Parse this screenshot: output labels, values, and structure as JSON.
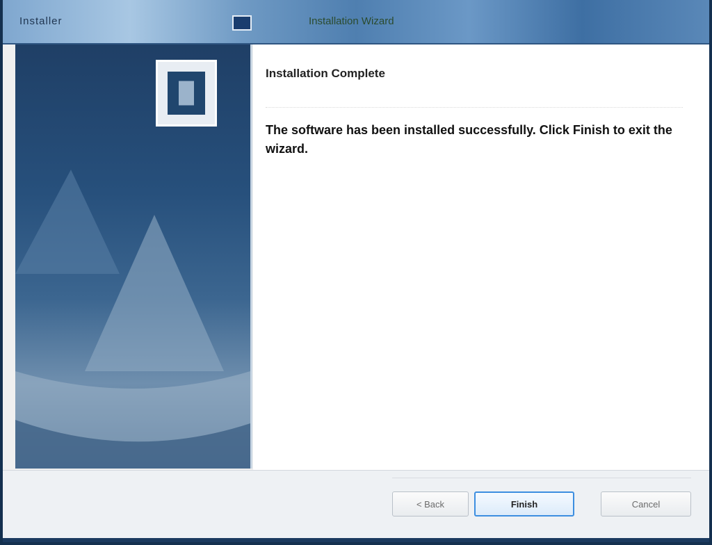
{
  "window": {
    "title": "Installer",
    "app_name": "Installation Wizard"
  },
  "main": {
    "heading": "Installation Complete",
    "message": "The software has been installed successfully. Click Finish to exit the wizard."
  },
  "footer": {
    "back_label": "< Back",
    "next_label": "Finish",
    "cancel_label": "Cancel"
  },
  "icons": {
    "window_icon": "app-window-icon",
    "logo": "product-logo-icon"
  },
  "colors": {
    "titlebar": "#5a88b8",
    "sidebar": "#27507c",
    "focus_border": "#3c8ee0"
  }
}
